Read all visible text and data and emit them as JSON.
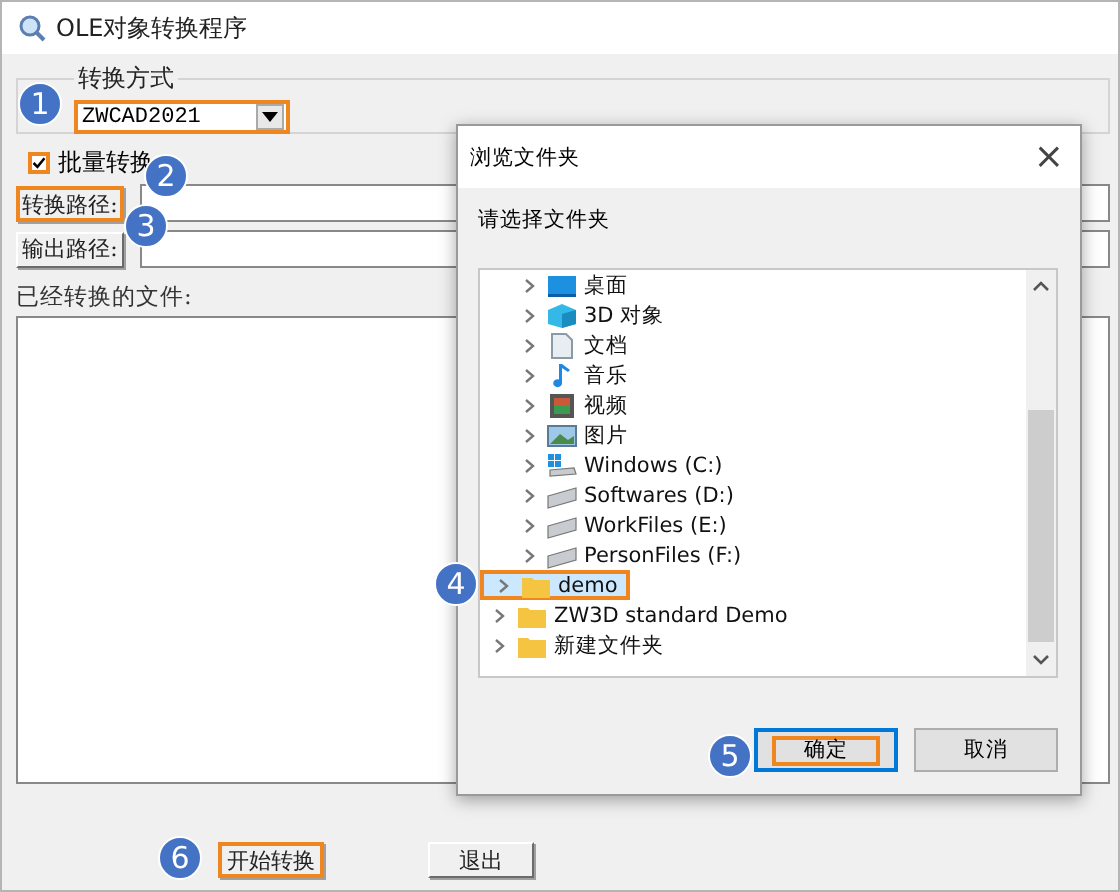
{
  "window": {
    "title": "OLE对象转换程序"
  },
  "mode_group": {
    "title": "转换方式",
    "combo": {
      "value": "ZWCAD2021",
      "highlighted": true
    }
  },
  "batch": {
    "label": "批量转换",
    "checked": true,
    "highlighted": true
  },
  "paths": [
    {
      "button": "转换路径:",
      "highlighted": true
    },
    {
      "button": "输出路径:",
      "highlighted": false
    }
  ],
  "files_label": "已经转换的文件:",
  "buttons": [
    {
      "label": "开始转换",
      "highlighted": true
    },
    {
      "label": "退出",
      "highlighted": false
    }
  ],
  "dialog": {
    "title": "浏览文件夹",
    "close": "×",
    "prompt": "请选择文件夹",
    "pc_items": [
      {
        "label": "桌面",
        "kind": "desktop",
        "selected": false,
        "highlighted": false
      },
      {
        "label": "3D 对象",
        "kind": "cube",
        "selected": false,
        "highlighted": false
      },
      {
        "label": "文档",
        "kind": "document",
        "selected": false,
        "highlighted": false
      },
      {
        "label": "音乐",
        "kind": "music",
        "selected": false,
        "highlighted": false
      },
      {
        "label": "视频",
        "kind": "video",
        "selected": false,
        "highlighted": false
      },
      {
        "label": "图片",
        "kind": "picture",
        "selected": false,
        "highlighted": false
      },
      {
        "label": "Windows (C:)",
        "kind": "system_drive",
        "selected": false,
        "highlighted": false
      },
      {
        "label": "Softwares (D:)",
        "kind": "drive",
        "selected": false,
        "highlighted": false
      },
      {
        "label": "WorkFiles (E:)",
        "kind": "drive",
        "selected": false,
        "highlighted": false
      },
      {
        "label": "PersonFiles (F:)",
        "kind": "drive",
        "selected": false,
        "highlighted": false
      }
    ],
    "folder_items": [
      {
        "label": "demo",
        "kind": "folder",
        "selected": true,
        "highlighted": true
      },
      {
        "label": "ZW3D standard Demo",
        "kind": "folder",
        "selected": false,
        "highlighted": false
      },
      {
        "label": "新建文件夹",
        "kind": "folder",
        "selected": false,
        "highlighted": false
      }
    ],
    "buttons": [
      {
        "label": "确定",
        "focused": true,
        "highlighted": true
      },
      {
        "label": "取消",
        "focused": false,
        "highlighted": false
      }
    ]
  },
  "callouts": [
    {
      "number": "1"
    },
    {
      "number": "2"
    },
    {
      "number": "3"
    },
    {
      "number": "4"
    },
    {
      "number": "5"
    },
    {
      "number": "6"
    }
  ]
}
